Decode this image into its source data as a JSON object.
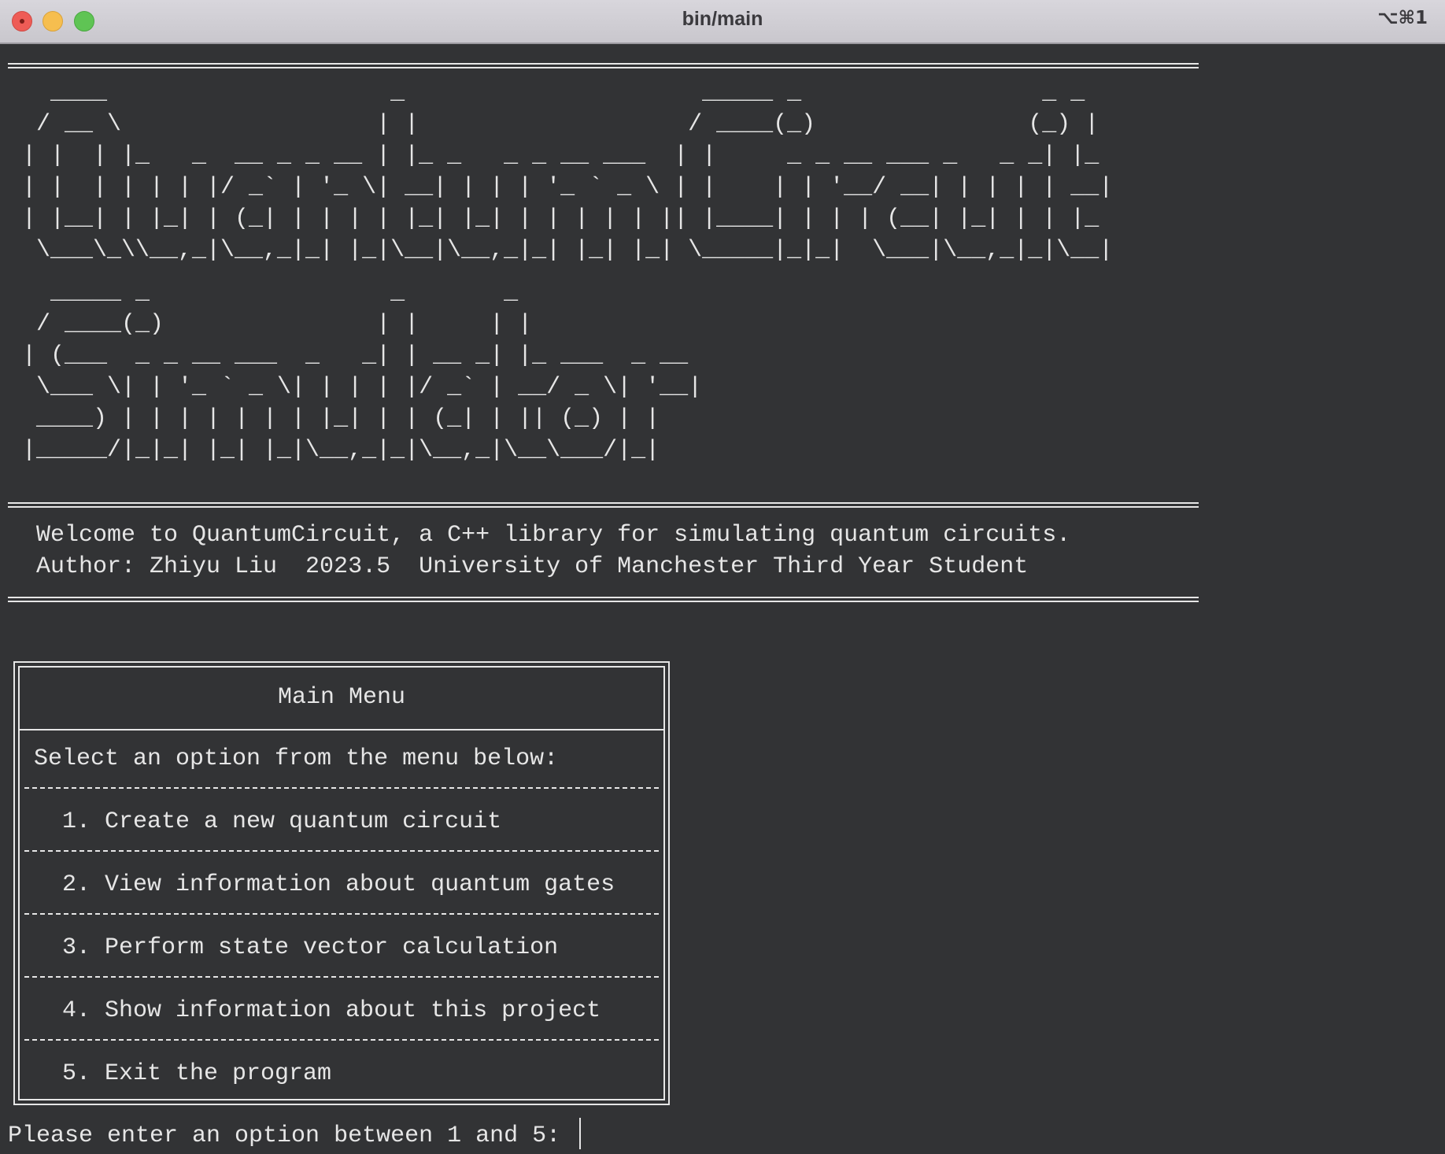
{
  "window": {
    "title": "bin/main",
    "shortcut": "⌥⌘1"
  },
  "banner": {
    "line1": "  ____                    _                     _____ _                 _ _   ",
    "line2": " / __ \\                  | |                   / ____(_)               (_) |  ",
    "line3": "| |  | |_   _  __ _ _ __ | |_ _   _ _ __ ___  | |     _ _ __ ___ _   _ _| |_ ",
    "line4": "| |  | | | | |/ _` | '_ \\| __| | | | '_ ` _ \\ | |    | | '__/ __| | | | | __|",
    "line5": "| |__| | |_| | (_| | | | | |_| |_| | | | | | || |____| | | | (__| |_| | | |_ ",
    "line6": " \\___\\_\\\\__,_|\\__,_|_| |_|\\__|\\__,_|_| |_| |_| \\_____|_|_|  \\___|\\__,_|_|\\__|",
    "line7": "  _____ _                 _       _             ",
    "line8": " / ____(_)               | |     | |            ",
    "line9": "| (___  _ _ __ ___  _   _| | __ _| |_ ___  _ __ ",
    "line10": " \\___ \\| | '_ ` _ \\| | | | |/ _` | __/ _ \\| '__|",
    "line11": " ____) | | | | | | | |_| | | (_| | || (_) | |   ",
    "line12": "|_____/|_|_| |_| |_|\\__,_|_|\\__,_|\\__\\___/|_|   "
  },
  "info": {
    "welcome": "Welcome to QuantumCircuit, a C++ library for simulating quantum circuits.",
    "author": "Author: Zhiyu Liu  2023.5  University of Manchester Third Year Student"
  },
  "menu": {
    "title": "Main Menu",
    "instruction": "Select an option from the menu below:",
    "items": [
      {
        "label": "1. Create a new quantum circuit"
      },
      {
        "label": "2. View information about quantum gates"
      },
      {
        "label": "3. Perform state vector calculation"
      },
      {
        "label": "4. Show information about this project"
      },
      {
        "label": "5. Exit the program"
      }
    ]
  },
  "prompt": {
    "text": "Please enter an option between 1 and 5: "
  }
}
